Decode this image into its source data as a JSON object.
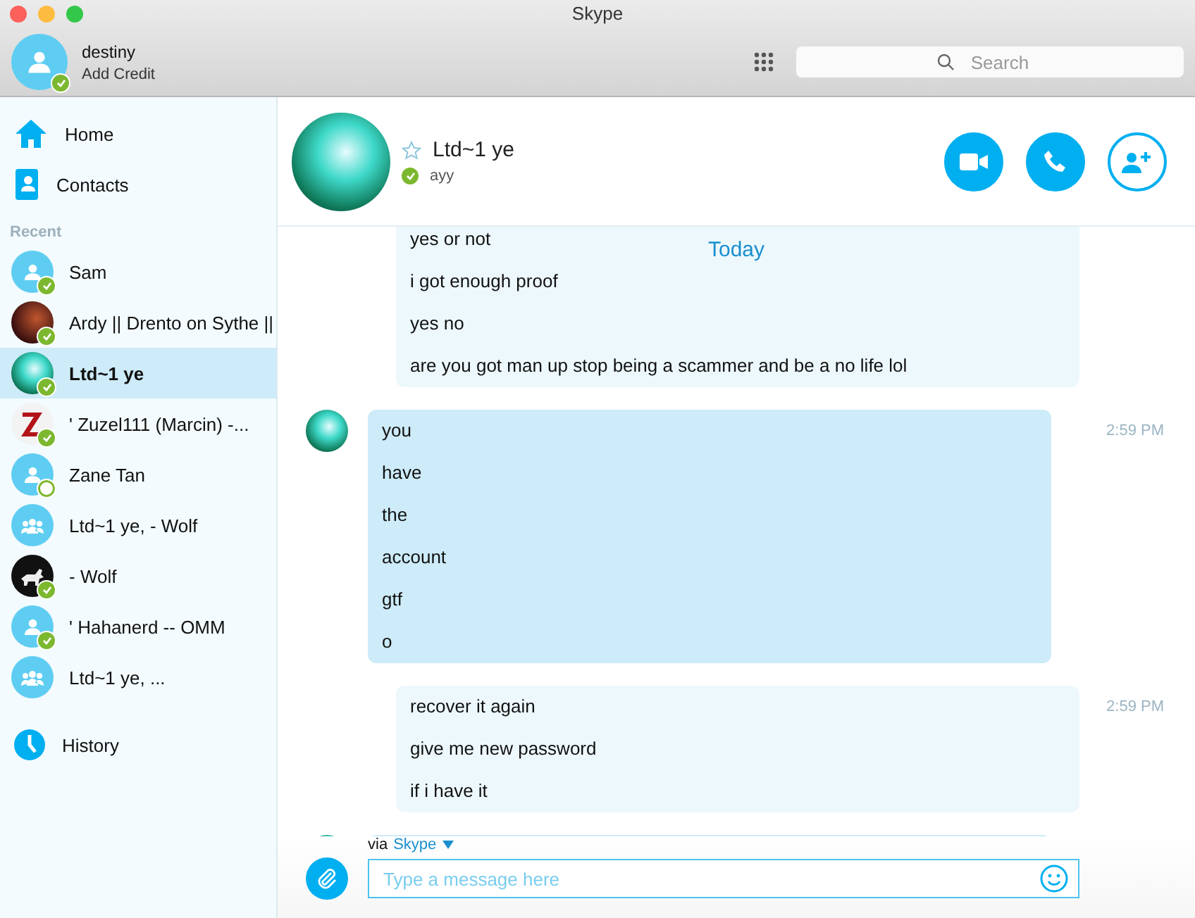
{
  "window": {
    "title": "Skype"
  },
  "profile": {
    "name": "destiny",
    "credit": "Add Credit",
    "online": true
  },
  "search": {
    "placeholder": "Search"
  },
  "nav": [
    {
      "label": "Home",
      "kind": "home"
    },
    {
      "label": "Contacts",
      "kind": "contacts"
    }
  ],
  "recent": {
    "heading": "Recent",
    "items": [
      {
        "name": "Sam",
        "kind": "person",
        "online": true,
        "selected": false
      },
      {
        "name": "Ardy || Drento on Sythe ||",
        "kind": "photo",
        "online": true,
        "selected": false
      },
      {
        "name": "Ltd~1 ye",
        "kind": "aurora",
        "online": true,
        "selected": true
      },
      {
        "name": "' Zuzel111 (Marcin) -...",
        "kind": "letter",
        "online": true,
        "selected": false
      },
      {
        "name": "Zane Tan",
        "kind": "person",
        "online": false,
        "selected": false
      },
      {
        "name": "Ltd~1 ye, - Wolf",
        "kind": "group",
        "selected": false
      },
      {
        "name": "- Wolf",
        "kind": "wolf",
        "online": true,
        "selected": false
      },
      {
        "name": "' Hahanerd -- OMM",
        "kind": "person",
        "online": true,
        "selected": false
      },
      {
        "name": "Ltd~1 ye, ...",
        "kind": "group",
        "selected": false
      }
    ]
  },
  "history": {
    "label": "History"
  },
  "chat": {
    "name": "Ltd~1 ye",
    "mood": "ayy",
    "online": true,
    "favorite": false
  },
  "date_separator": "Today",
  "messages": [
    {
      "kind": "outgoing",
      "lines": [
        "yes or not",
        "i got enough proof",
        "yes no",
        "are you got man up stop being a scammer and be a no life lol"
      ]
    },
    {
      "kind": "incoming",
      "time": "2:59 PM",
      "lines": [
        "you",
        "have",
        "the",
        "account",
        "gtf",
        "o"
      ]
    },
    {
      "kind": "outgoing",
      "time": "2:59 PM",
      "lines": [
        "recover it again",
        "give me new password",
        "if i have it"
      ]
    },
    {
      "kind": "incoming"
    }
  ],
  "compose": {
    "via": "via",
    "service": "Skype",
    "placeholder": "Type a message here"
  }
}
